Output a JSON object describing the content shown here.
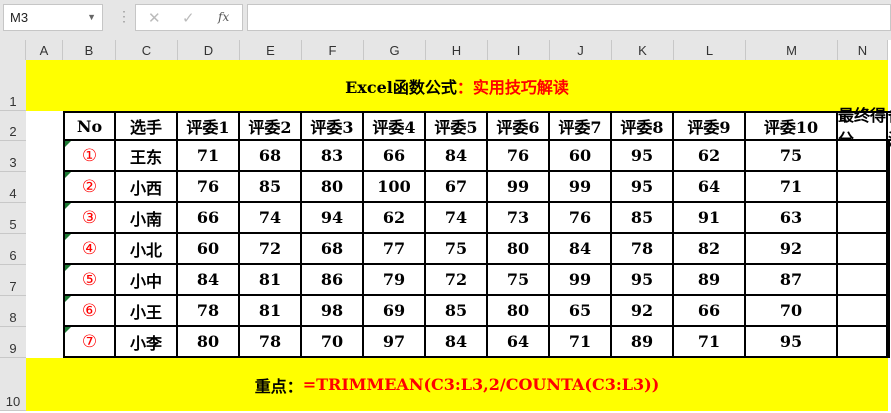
{
  "name_box": "M3",
  "formula_bar": {
    "cancel_icon": "✕",
    "enter_icon": "✓",
    "fx_label": "fx",
    "value": ""
  },
  "columns": [
    "A",
    "B",
    "C",
    "D",
    "E",
    "F",
    "G",
    "H",
    "I",
    "J",
    "K",
    "L",
    "M",
    "N"
  ],
  "rows": [
    "1",
    "2",
    "3",
    "4",
    "5",
    "6",
    "7",
    "8",
    "9",
    "10"
  ],
  "title": {
    "black": "Excel函数公式",
    "red": "：实用技巧解读"
  },
  "headers": [
    "No",
    "选手",
    "评委1",
    "评委2",
    "评委3",
    "评委4",
    "评委5",
    "评委6",
    "评委7",
    "评委8",
    "评委9",
    "评委10",
    "最终得分",
    "备注"
  ],
  "data": [
    {
      "no": "①",
      "name": "王东",
      "scores": [
        "71",
        "68",
        "83",
        "66",
        "84",
        "76",
        "60",
        "95",
        "62",
        "75"
      ]
    },
    {
      "no": "②",
      "name": "小西",
      "scores": [
        "76",
        "85",
        "80",
        "100",
        "67",
        "99",
        "99",
        "95",
        "64",
        "71"
      ]
    },
    {
      "no": "③",
      "name": "小南",
      "scores": [
        "66",
        "74",
        "94",
        "62",
        "74",
        "73",
        "76",
        "85",
        "91",
        "63"
      ]
    },
    {
      "no": "④",
      "name": "小北",
      "scores": [
        "60",
        "72",
        "68",
        "77",
        "75",
        "80",
        "84",
        "78",
        "82",
        "92"
      ]
    },
    {
      "no": "⑤",
      "name": "小中",
      "scores": [
        "84",
        "81",
        "86",
        "79",
        "72",
        "75",
        "99",
        "95",
        "89",
        "87"
      ]
    },
    {
      "no": "⑥",
      "name": "小王",
      "scores": [
        "78",
        "81",
        "98",
        "69",
        "85",
        "80",
        "65",
        "92",
        "66",
        "70"
      ]
    },
    {
      "no": "⑦",
      "name": "小李",
      "scores": [
        "80",
        "78",
        "70",
        "97",
        "84",
        "64",
        "71",
        "89",
        "71",
        "95"
      ]
    }
  ],
  "footer": {
    "black": "重点：",
    "red": "=TRIMMEAN(C3:L3,2/COUNTA(C3:L3))"
  },
  "colors": {
    "highlight": "#FFFF00",
    "accent": "#FF0000"
  }
}
